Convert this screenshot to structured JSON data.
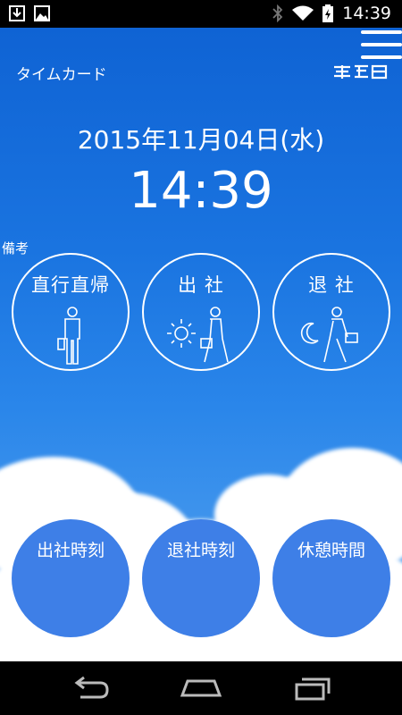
{
  "status": {
    "time": "14:39",
    "icons": [
      "download-icon",
      "gallery-icon",
      "bluetooth-icon",
      "wifi-icon",
      "battery-icon"
    ]
  },
  "app": {
    "title": "タイムカード"
  },
  "datetime": {
    "date": "2015年11月04日(水)",
    "time": "14:39"
  },
  "memo_label": "備考",
  "actions": {
    "direct": {
      "label": "直行直帰",
      "icon": "person-icon"
    },
    "arrive": {
      "label": "出 社",
      "icon": "sun-walking-person-icon"
    },
    "leave": {
      "label": "退 社",
      "icon": "moon-walking-person-icon"
    }
  },
  "records": {
    "arrive_time": {
      "label": "出社時刻"
    },
    "leave_time": {
      "label": "退社時刻"
    },
    "break_time": {
      "label": "休憩時間"
    }
  },
  "colors": {
    "primary": "#1a74e0",
    "button_fill": "#3e7fe7"
  }
}
